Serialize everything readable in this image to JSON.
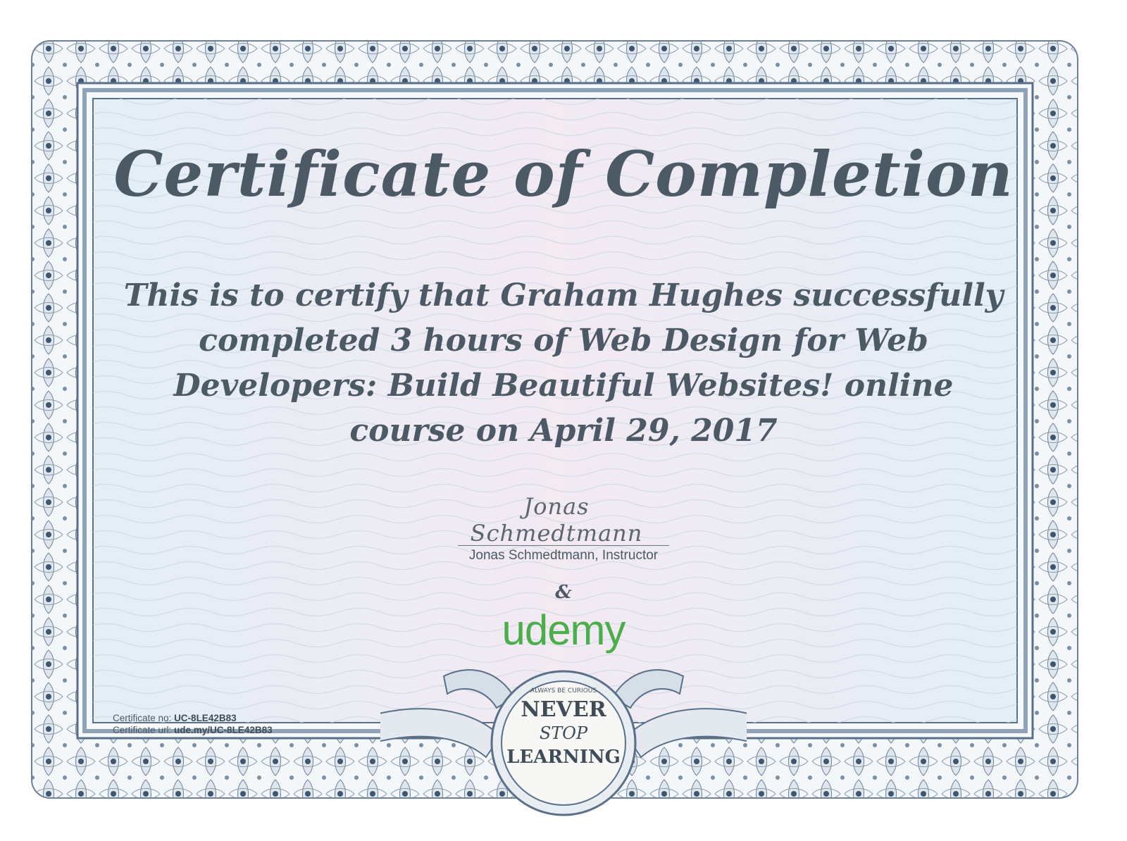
{
  "certificate": {
    "title": "Certificate of Completion",
    "body_text": "This is to certify that Graham Hughes successfully completed 3 hours of Web Design for Web Developers: Build Beautiful Websites! online course on April 29, 2017",
    "signature": "Jonas Schmedtmann",
    "signature_caption": "Jonas Schmedtmann, Instructor",
    "ampersand": "&",
    "logo_text": "udemy",
    "certificate_no_label": "Certificate no:",
    "certificate_no": "UC-8LE42B83",
    "certificate_url_label": "Certificate url:",
    "certificate_url": "ude.my/UC-8LE42B83"
  },
  "seal": {
    "top_text": "ALWAYS BE CURIOUS",
    "line1": "NEVER",
    "line2": "STOP",
    "line3": "LEARNING"
  },
  "colors": {
    "ink": "#4c5a66",
    "border": "#5a7089",
    "brand_green": "#4aae4a"
  }
}
